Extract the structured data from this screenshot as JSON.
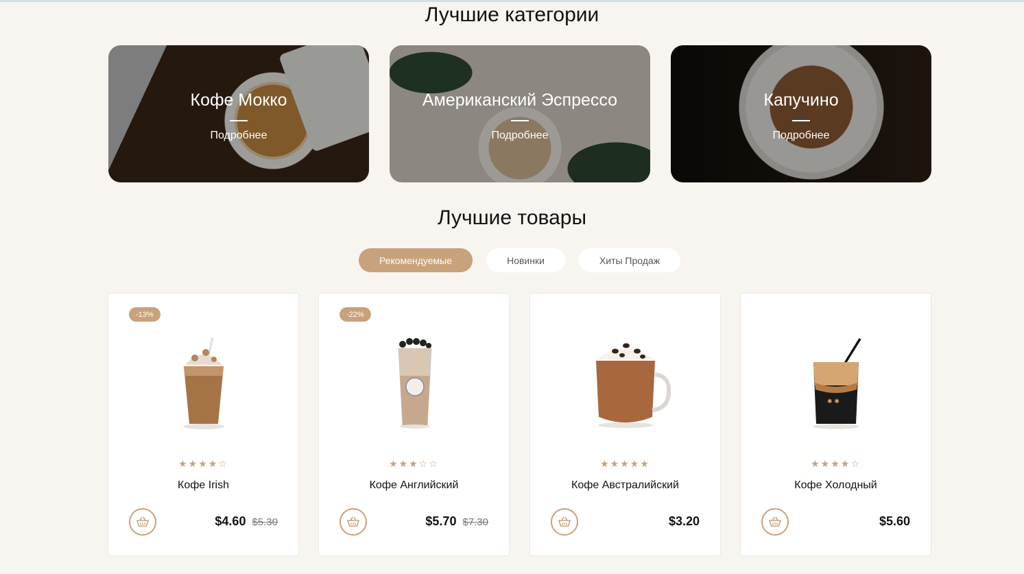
{
  "categories_section": {
    "title": "Лучшие категории",
    "items": [
      {
        "name": "Кофе Мокко",
        "more": "Подробнее"
      },
      {
        "name": "Американский Эспрессо",
        "more": "Подробнее"
      },
      {
        "name": "Капучино",
        "more": "Подробнее"
      }
    ]
  },
  "products_section": {
    "title": "Лучшие товары",
    "tabs": [
      {
        "label": "Рекомендуемые",
        "active": true
      },
      {
        "label": "Новинки",
        "active": false
      },
      {
        "label": "Хиты Продаж",
        "active": false
      }
    ],
    "items": [
      {
        "badge": "-13%",
        "name": "Кофе Irish",
        "rating": 4,
        "stars": "★★★★☆",
        "price": "$4.60",
        "old_price": "$5.30"
      },
      {
        "badge": "-22%",
        "name": "Кофе Английский",
        "rating": 3,
        "stars": "★★★☆☆",
        "price": "$5.70",
        "old_price": "$7.30"
      },
      {
        "badge": "",
        "name": "Кофе Австралийский",
        "rating": 5,
        "stars": "★★★★★",
        "price": "$3.20",
        "old_price": ""
      },
      {
        "badge": "",
        "name": "Кофе Холодный",
        "rating": 4,
        "stars": "★★★★☆",
        "price": "$5.60",
        "old_price": ""
      }
    ]
  },
  "colors": {
    "accent": "#c8a27a",
    "background": "#f8f5f1"
  },
  "icons": {
    "cart": "basket-icon",
    "star": "star-icon"
  }
}
